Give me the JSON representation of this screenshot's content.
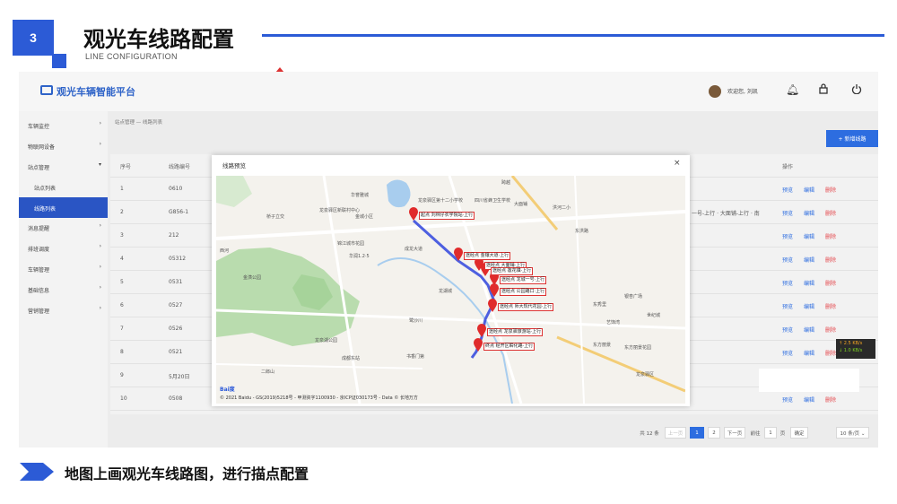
{
  "slide": {
    "badge": "3",
    "title": "观光车线路配置",
    "subtitle": "LINE CONFIGURATION",
    "footer_text": "地图上画观光车线路图，进行描点配置",
    "accent_color": "#2c5bd6"
  },
  "app": {
    "name": "观光车辆智能平台",
    "welcome": "欢迎您, 刘凯",
    "icons": [
      "bell-icon",
      "lock-icon",
      "power-icon"
    ]
  },
  "sidebar": {
    "items": [
      {
        "label": "车辆监控",
        "arrow": "›"
      },
      {
        "label": "物联网设备",
        "arrow": "›"
      },
      {
        "label": "站点管理",
        "arrow": "▾"
      },
      {
        "label": "站点列表",
        "arrow": ""
      },
      {
        "label": "线路列表",
        "arrow": ""
      },
      {
        "label": "消息提醒",
        "arrow": "›"
      },
      {
        "label": "排班调度",
        "arrow": "›"
      },
      {
        "label": "车辆管理",
        "arrow": "›"
      },
      {
        "label": "基础信息",
        "arrow": "›"
      },
      {
        "label": "营销管理",
        "arrow": "›"
      }
    ]
  },
  "breadcrumb": "站点管理 — 线路列表",
  "add_button": "+ 新增线路",
  "table": {
    "headers": [
      "序号",
      "线路编号",
      "操作"
    ],
    "rows": [
      {
        "no": "1",
        "code": "0610",
        "extra": ""
      },
      {
        "no": "2",
        "code": "G856-1",
        "extra": "一号-上行 · 大面铺-上行 · 南"
      },
      {
        "no": "3",
        "code": "212",
        "extra": ""
      },
      {
        "no": "4",
        "code": "05312",
        "extra": ""
      },
      {
        "no": "5",
        "code": "0531",
        "extra": ""
      },
      {
        "no": "6",
        "code": "0527",
        "extra": ""
      },
      {
        "no": "7",
        "code": "0526",
        "extra": ""
      },
      {
        "no": "8",
        "code": "0521",
        "extra": ""
      },
      {
        "no": "9",
        "code": "5月20日",
        "extra": ""
      },
      {
        "no": "10",
        "code": "0508",
        "extra": ""
      }
    ],
    "actions": [
      "预览",
      "编辑",
      "删除"
    ]
  },
  "pager": {
    "total": "共 12 条",
    "prev": "上一页",
    "pages": [
      "1",
      "2"
    ],
    "next": "下一页",
    "goto": "前往",
    "page_input": "1",
    "page_unit": "页",
    "confirm": "确定",
    "page_size": "10 条/页 ⌄"
  },
  "speed": {
    "up": "↑ 2.5 KB/s",
    "down": "↓ 1.0 KB/s"
  },
  "modal": {
    "title": "线路预览",
    "close": "×",
    "copyright": "© 2021 Baidu - GS(2019)5218号 - 甲测资字1100930 - 京ICP证030173号 - Data © 长地万方",
    "baidu": "Bai度",
    "stops": [
      "起点 刘林仔农学院站·上行",
      "途经点 金镶大道·上行",
      "途经点 大面铺·上行",
      "途经点 莲花镇·上行",
      "途经点 龙城一号·上行",
      "途经点 公园路口·上行",
      "途经点 师大现代花园·上行",
      "途经点 龙泉驿旅游站·上行",
      "终点 经开区瞬化路·上行"
    ],
    "map_labels": [
      "华誉雅城",
      "龙泉驿区第十二小学校",
      "四川省蜂卫生学校",
      "跨越",
      "洪河二小",
      "桥子立交",
      "龙泉驿区新联村中心",
      "金城小区",
      "锦江城市花园",
      "华润1.2·5",
      "成龙大道",
      "东洪路",
      "西河",
      "金潢公园",
      "龙湖城",
      "鹭沙川",
      "书香门第",
      "东方丽景",
      "东秀里",
      "世纪城",
      "龙泉湖公园",
      "二郎山",
      "银杏广场",
      "龙泉驿区",
      "东方丽景花园",
      "艺饰湾",
      "大面铺",
      "成都东站"
    ]
  }
}
